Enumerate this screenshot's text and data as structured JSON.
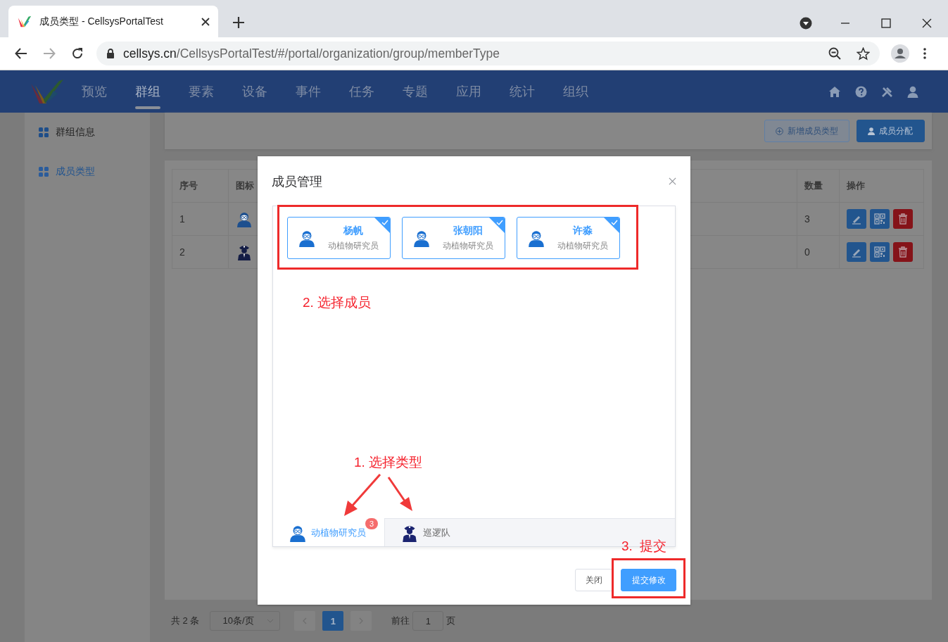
{
  "browser": {
    "tab_title": "成员类型 - CellsysPortalTest",
    "url_host": "cellsys.cn",
    "url_path": "/CellsysPortalTest/#/portal/organization/group/memberType"
  },
  "nav": [
    {
      "label": "预览",
      "selected": false
    },
    {
      "label": "群组",
      "selected": true
    },
    {
      "label": "要素",
      "selected": false
    },
    {
      "label": "设备",
      "selected": false
    },
    {
      "label": "事件",
      "selected": false
    },
    {
      "label": "任务",
      "selected": false
    },
    {
      "label": "专题",
      "selected": false
    },
    {
      "label": "应用",
      "selected": false
    },
    {
      "label": "统计",
      "selected": false
    },
    {
      "label": "组织",
      "selected": false
    }
  ],
  "sidebar": {
    "items": [
      {
        "label": "群组信息",
        "selected": false
      },
      {
        "label": "成员类型",
        "selected": true
      }
    ]
  },
  "toolbar": {
    "buttons": [
      {
        "label": "新增成员类型",
        "kind": "outline"
      },
      {
        "label": "成员分配",
        "kind": "primary"
      }
    ]
  },
  "table": {
    "columns": [
      "序号",
      "图标",
      "数量",
      "操作"
    ],
    "rows": [
      {
        "index": "1",
        "kind": "researcher",
        "count": "3"
      },
      {
        "index": "2",
        "kind": "officer",
        "count": "0"
      }
    ]
  },
  "pagination": {
    "total": "共 2 条",
    "page_size": "10条/页",
    "pages": [
      {
        "label": "1",
        "selected": true
      }
    ],
    "goto_label": "前往",
    "goto_value": "1",
    "page_unit": "页"
  },
  "dialog": {
    "title": "成员管理",
    "members": [
      {
        "name": "杨帆",
        "role": "动植物研究员",
        "checked": true
      },
      {
        "name": "张朝阳",
        "role": "动植物研究员",
        "checked": true
      },
      {
        "name": "许淼",
        "role": "动植物研究员",
        "checked": true
      }
    ],
    "types": [
      {
        "label": "动植物研究员",
        "kind": "researcher",
        "badge": "3",
        "selected": true
      },
      {
        "label": "巡逻队",
        "kind": "officer",
        "selected": false
      }
    ],
    "buttons": [
      {
        "label": "关闭",
        "kind": "default"
      },
      {
        "label": "提交修改",
        "kind": "primary"
      }
    ]
  },
  "annotations": [
    {
      "text": "2. 选择成员"
    },
    {
      "text": "1. 选择类型"
    },
    {
      "text": "3.  提交"
    }
  ]
}
